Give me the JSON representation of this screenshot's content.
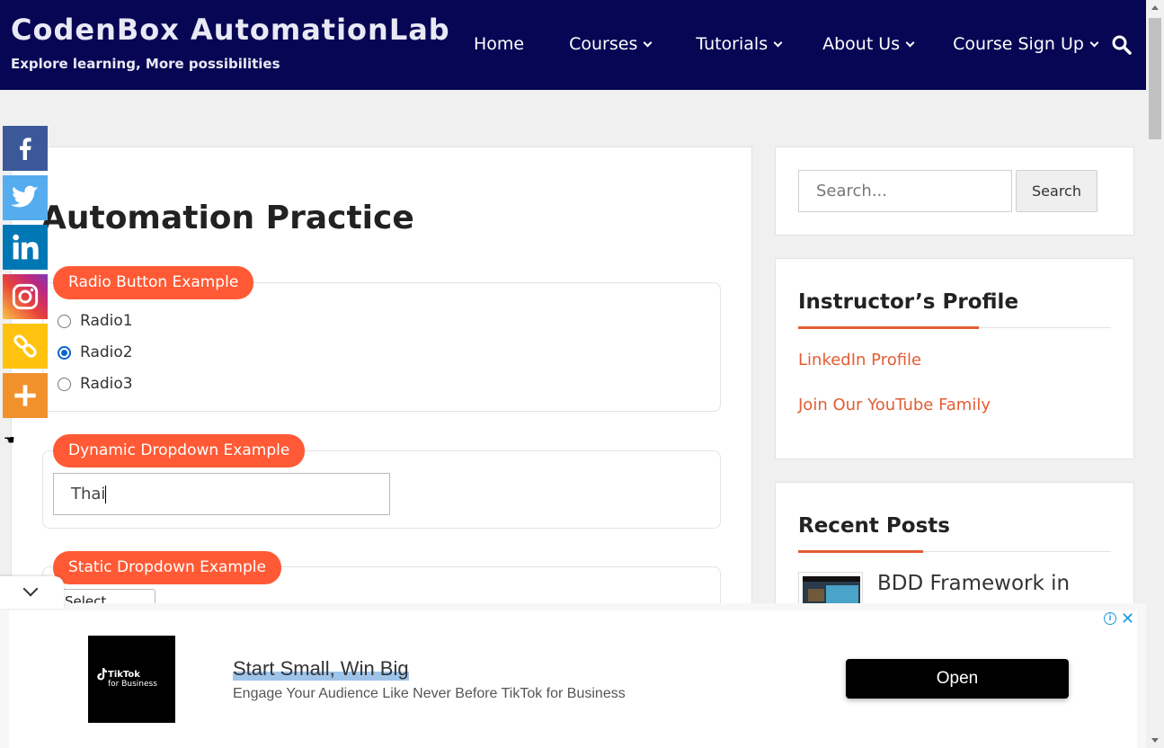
{
  "header": {
    "brand_title": "CodenBox AutomationLab",
    "brand_tagline": "Explore learning, More possibilities",
    "nav": [
      {
        "label": "Home",
        "has_dropdown": false
      },
      {
        "label": "Courses",
        "has_dropdown": true
      },
      {
        "label": "Tutorials",
        "has_dropdown": true
      },
      {
        "label": "About Us",
        "has_dropdown": true
      },
      {
        "label": "Course Sign Up",
        "has_dropdown": true
      }
    ],
    "search_icon": "search-icon"
  },
  "main": {
    "page_title": "Automation Practice",
    "radio_section": {
      "legend": "Radio Button Example",
      "options": [
        {
          "label": "Radio1",
          "checked": false
        },
        {
          "label": "Radio2",
          "checked": true
        },
        {
          "label": "Radio3",
          "checked": false
        }
      ]
    },
    "dynamic_dropdown": {
      "legend": "Dynamic Dropdown Example",
      "value": "Thai"
    },
    "static_dropdown": {
      "legend": "Static Dropdown Example",
      "selected": "Select"
    }
  },
  "social_bar": {
    "icons": [
      "facebook-icon",
      "twitter-icon",
      "linkedin-icon",
      "instagram-icon",
      "copy-link-icon",
      "more-icon"
    ],
    "hide_icon": "hand-pointer-icon"
  },
  "sidebar": {
    "search": {
      "placeholder": "Search...",
      "button": "Search"
    },
    "instructor": {
      "title": "Instructor’s Profile",
      "links": [
        "LinkedIn Profile",
        "Join Our YouTube Family"
      ]
    },
    "recent_posts": {
      "title": "Recent Posts",
      "first_post": "BDD Framework in"
    }
  },
  "ad": {
    "logo_line1": "TikTok",
    "logo_line2": "for Business",
    "title": "Start Small, Win Big",
    "description": "Engage Your Audience Like Never Before TikTok for Business",
    "button": "Open",
    "info_icon": "i",
    "close_icon": "✕"
  },
  "colors": {
    "header_bg": "#070654",
    "accent": "#ff5a35",
    "link": "#e35d33",
    "facebook": "#3b5998",
    "twitter": "#55acee",
    "linkedin": "#0077b5",
    "copy": "#ffc30f",
    "more": "#f0912c"
  }
}
